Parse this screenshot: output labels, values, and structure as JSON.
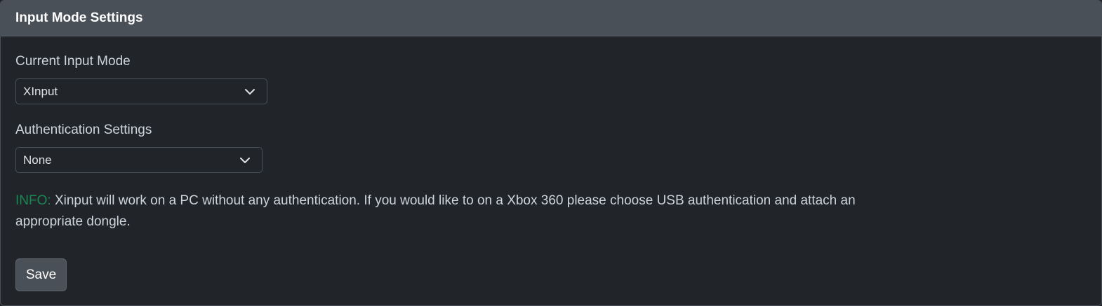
{
  "header": {
    "title": "Input Mode Settings"
  },
  "input_mode": {
    "label": "Current Input Mode",
    "selected": "XInput"
  },
  "authentication": {
    "label": "Authentication Settings",
    "selected": "None"
  },
  "info": {
    "label": "INFO:",
    "text": " Xinput will work on a PC without any authentication. If you would like to on a Xbox 360 please choose USB authentication and attach an appropriate dongle."
  },
  "actions": {
    "save_label": "Save"
  },
  "colors": {
    "background": "#212529",
    "header": "#495057",
    "info_accent": "#198754",
    "button": "#495057"
  },
  "icons": {
    "select_chevron": "chevron-down-icon"
  }
}
